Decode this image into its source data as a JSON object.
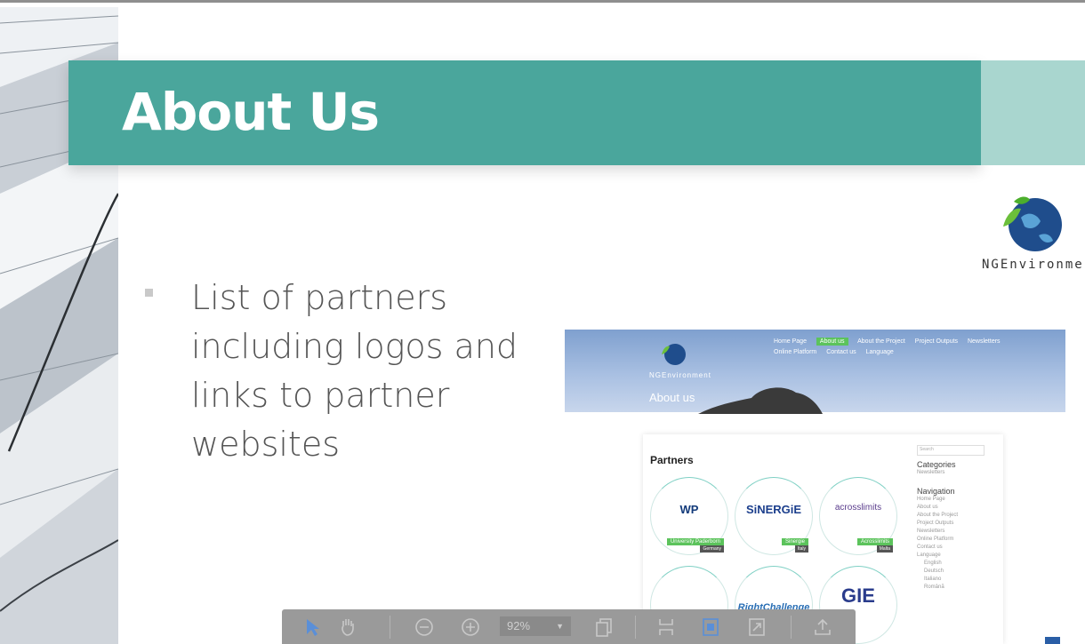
{
  "slide": {
    "title": "About Us",
    "bullet": "List of partners including logos and links to partner websites",
    "brand_name": "NGEnvironment",
    "colors": {
      "title_band": "#4aa69c",
      "title_accent": "#a9d6cf",
      "bullet_text": "#555555"
    }
  },
  "screenshot": {
    "nav_items": [
      "Home Page",
      "About us",
      "About the Project",
      "Project Outputs",
      "Newsletters",
      "Online Platform",
      "Contact us",
      "Language"
    ],
    "active_nav": "About us",
    "brand": "NGEnvironment",
    "hero_title": "About us",
    "section_title": "Partners",
    "partners": [
      {
        "logo": "WP",
        "name": "University Paderborn",
        "country": "Germany"
      },
      {
        "logo": "SiNERGiE",
        "name": "Sinergie",
        "country": "Italy"
      },
      {
        "logo": "acrosslimits",
        "name": "Acrosslimits",
        "country": "Malta"
      }
    ],
    "row2_logos": [
      "",
      "RightChallenge",
      "GIE"
    ],
    "sidebar": {
      "search_placeholder": "Search",
      "categories_heading": "Categories",
      "categories": [
        "Newsletters"
      ],
      "navigation_heading": "Navigation",
      "navigation": [
        "Home Page",
        "About us",
        "About the Project",
        "Project Outputs",
        "Newsletters",
        "Online Platform",
        "Contact us",
        "Language",
        "English",
        "Deutsch",
        "Italiano",
        "Română"
      ]
    }
  },
  "viewer_toolbar": {
    "zoom_value": "92%",
    "icons": [
      "select-arrow-icon",
      "hand-tool-icon",
      "zoom-out-icon",
      "zoom-in-icon",
      "copy-page-icon",
      "fit-width-icon",
      "fit-page-icon",
      "expand-icon",
      "share-upload-icon"
    ]
  }
}
